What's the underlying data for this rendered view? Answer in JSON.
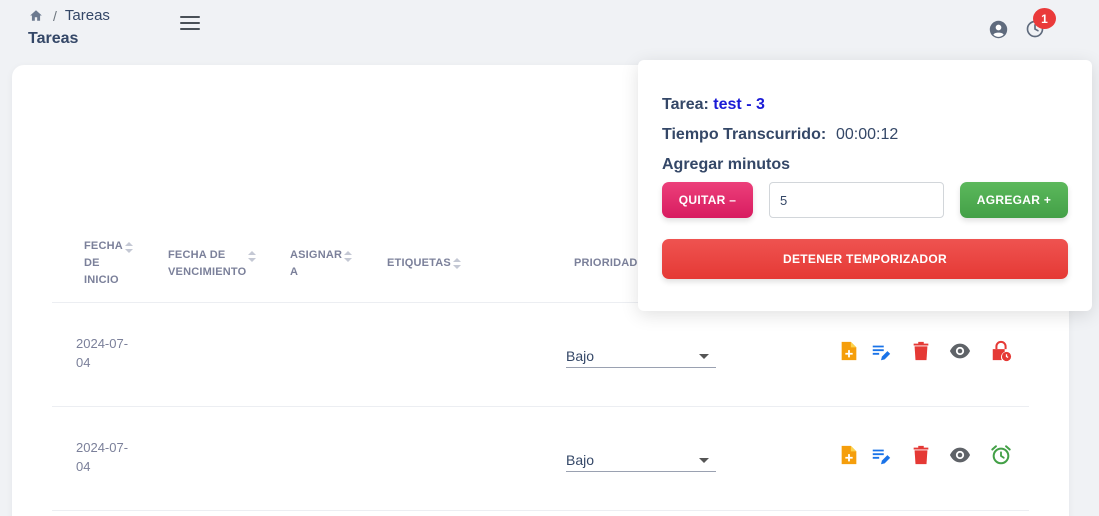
{
  "breadcrumb": {
    "current": "Tareas",
    "separator": "/"
  },
  "page_title": "Tareas",
  "notifications": {
    "count": "1"
  },
  "table": {
    "headers": {
      "start_date": [
        "Fecha",
        "de",
        "inicio"
      ],
      "due_date": [
        "Fecha de",
        "vencimiento"
      ],
      "assign": [
        "Asignar",
        "a"
      ],
      "tags": "Etiquetas",
      "priority": "Prioridad"
    },
    "rows": [
      {
        "start_date": [
          "2024-07-",
          "04"
        ],
        "priority": "Bajo",
        "timer_state": "active"
      },
      {
        "start_date": [
          "2024-07-",
          "04"
        ],
        "priority": "Bajo",
        "timer_state": "idle"
      }
    ]
  },
  "timer_popover": {
    "task_label": "Tarea:",
    "task_name": "test - 3",
    "elapsed_label": "Tiempo Transcurrido:",
    "elapsed_value": "00:00:12",
    "add_minutes_label": "Agregar minutos",
    "minutes_value": "5",
    "remove_button": "QUITAR –",
    "add_button": "AGREGAR +",
    "stop_button": "DETENER TEMPORIZADOR"
  },
  "colors": {
    "pink": "#d81b60",
    "green": "#43a047",
    "red": "#e53935",
    "orange": "#f59e0b",
    "blue": "#1a73e8",
    "task_blue": "#1a1ad6"
  }
}
